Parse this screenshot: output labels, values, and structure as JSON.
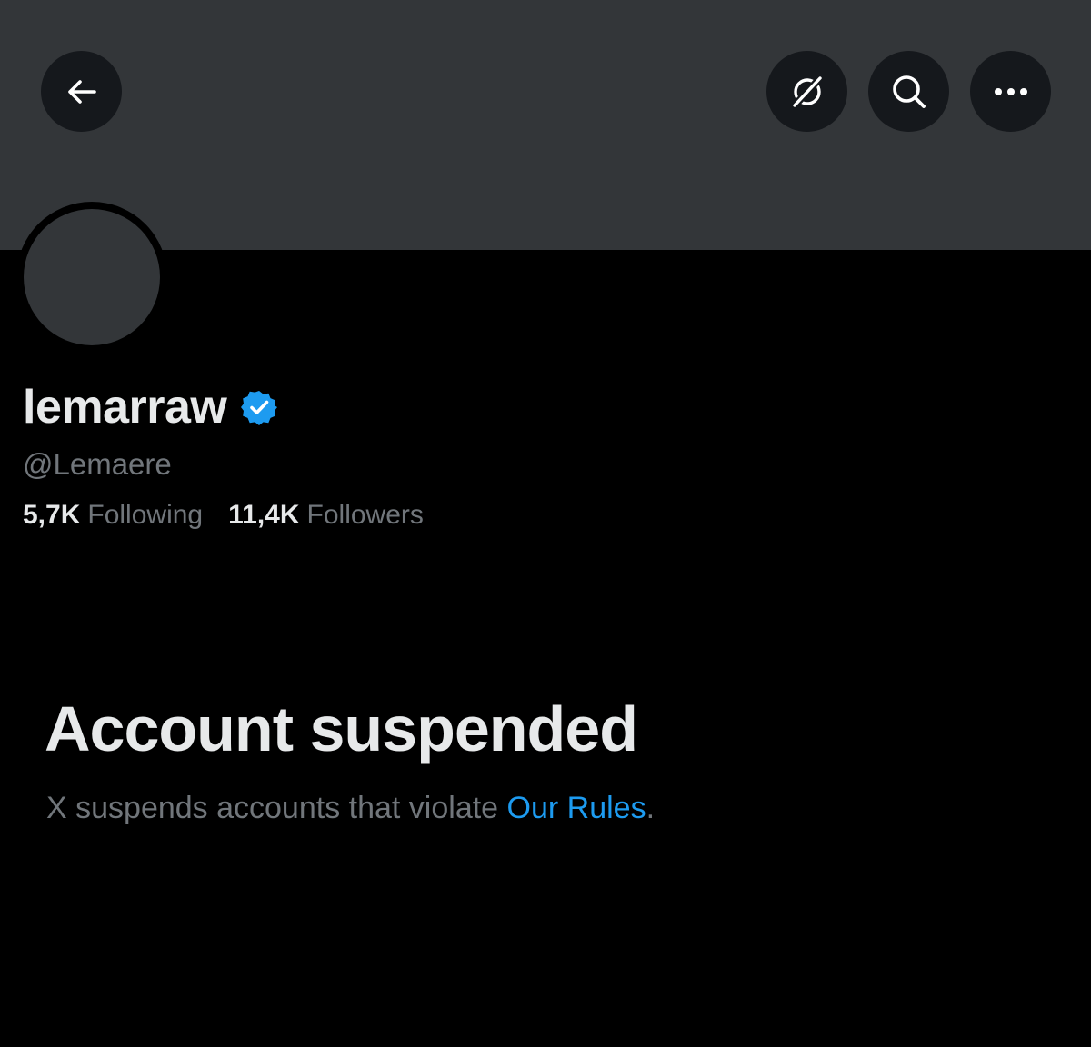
{
  "header": {
    "back_icon": "arrow-left-icon",
    "grok_icon": "grok-icon",
    "search_icon": "search-icon",
    "more_icon": "more-horizontal-icon"
  },
  "profile": {
    "display_name": "lemarraw",
    "verified_icon": "verified-badge-icon",
    "handle": "@Lemaere",
    "following_count": "5,7K",
    "following_label": "Following",
    "followers_count": "11,4K",
    "followers_label": "Followers"
  },
  "notice": {
    "title": "Account suspended",
    "text_before": "X suspends accounts that violate ",
    "link_text": "Our Rules",
    "text_after": "."
  },
  "colors": {
    "background": "#000000",
    "banner": "#333639",
    "button_bg": "#15181c",
    "primary_text": "#e7e9ea",
    "secondary_text": "#71767b",
    "link": "#1d9bf0",
    "verified_badge": "#1d9bf0"
  }
}
